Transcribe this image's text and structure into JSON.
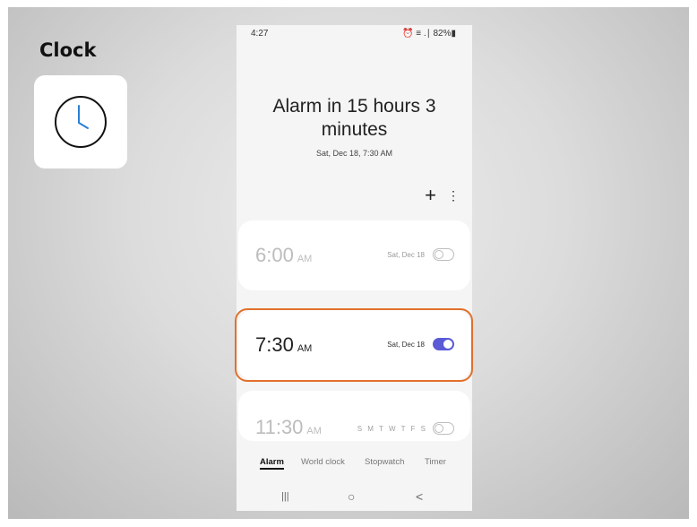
{
  "slide": {
    "title": "Clock",
    "app_icon": "clock-icon"
  },
  "status_bar": {
    "time": "4:27",
    "indicators": "⏰ ≡ .∣ 82%▮"
  },
  "header": {
    "alarm_title": "Alarm in 15 hours 3 minutes",
    "alarm_subtitle": "Sat, Dec 18, 7:30 AM",
    "add_icon": "+",
    "more_icon": "⋮"
  },
  "alarms": [
    {
      "time": "6:00",
      "ampm": "AM",
      "date": "Sat, Dec 18",
      "enabled": false
    },
    {
      "time": "7:30",
      "ampm": "AM",
      "date": "Sat, Dec 18",
      "enabled": true
    },
    {
      "time": "11:30",
      "ampm": "AM",
      "days": "S M T W T F S",
      "enabled": false
    }
  ],
  "tabs": [
    "Alarm",
    "World clock",
    "Stopwatch",
    "Timer"
  ],
  "active_tab": "Alarm",
  "navbar": {
    "recents": "|||",
    "home": "○",
    "back": "<"
  },
  "colors": {
    "highlight": "#e2702a",
    "toggle_on": "#5a5ad6"
  }
}
